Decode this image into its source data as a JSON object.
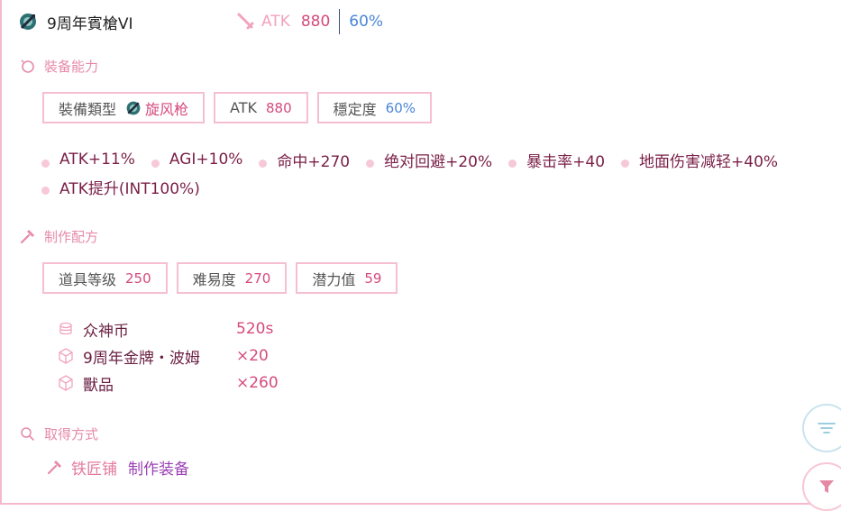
{
  "header": {
    "item_name": "9周年賓槍VI",
    "atk_label": "ATK",
    "atk_value": "880",
    "stability_value": "60%"
  },
  "equip": {
    "title": "裝备能力",
    "boxes": {
      "type_label": "裝備類型",
      "type_value": "旋风枪",
      "atk_label": "ATK",
      "atk_value": "880",
      "stability_label": "穩定度",
      "stability_value": "60%"
    },
    "stats_line1": [
      "ATK+11%",
      "AGI+10%",
      "命中+270",
      "绝对回避+20%",
      "暴击率+40",
      "地面伤害减轻+40%"
    ],
    "stats_line2": [
      "ATK提升(INT100%)"
    ]
  },
  "craft": {
    "title": "制作配方",
    "boxes": {
      "level_label": "道具等级",
      "level_value": "250",
      "difficulty_label": "难易度",
      "difficulty_value": "270",
      "potential_label": "潜力值",
      "potential_value": "59"
    },
    "materials": [
      {
        "icon": "coins-icon",
        "name": "众神币",
        "value": "520s"
      },
      {
        "icon": "cube-icon",
        "name": "9周年金牌・波姆",
        "value": "×20"
      },
      {
        "icon": "cube-icon",
        "name": "獸品",
        "value": "×260"
      }
    ]
  },
  "acquire": {
    "title": "取得方式",
    "label": "铁匠铺",
    "link": "制作装备"
  },
  "colors": {
    "accent_pink": "#d54a7c",
    "section_pink": "#e78aa8",
    "stability_blue": "#4a86d8",
    "border_pink": "#f6bfd0"
  },
  "icons": {
    "weapon": "halberd-icon",
    "atk": "sword-icon",
    "equip_section": "ring-icon",
    "craft_section": "hammer-icon",
    "acquire_section": "search-icon",
    "fab1": "sort-icon",
    "fab2": "filter-icon"
  }
}
